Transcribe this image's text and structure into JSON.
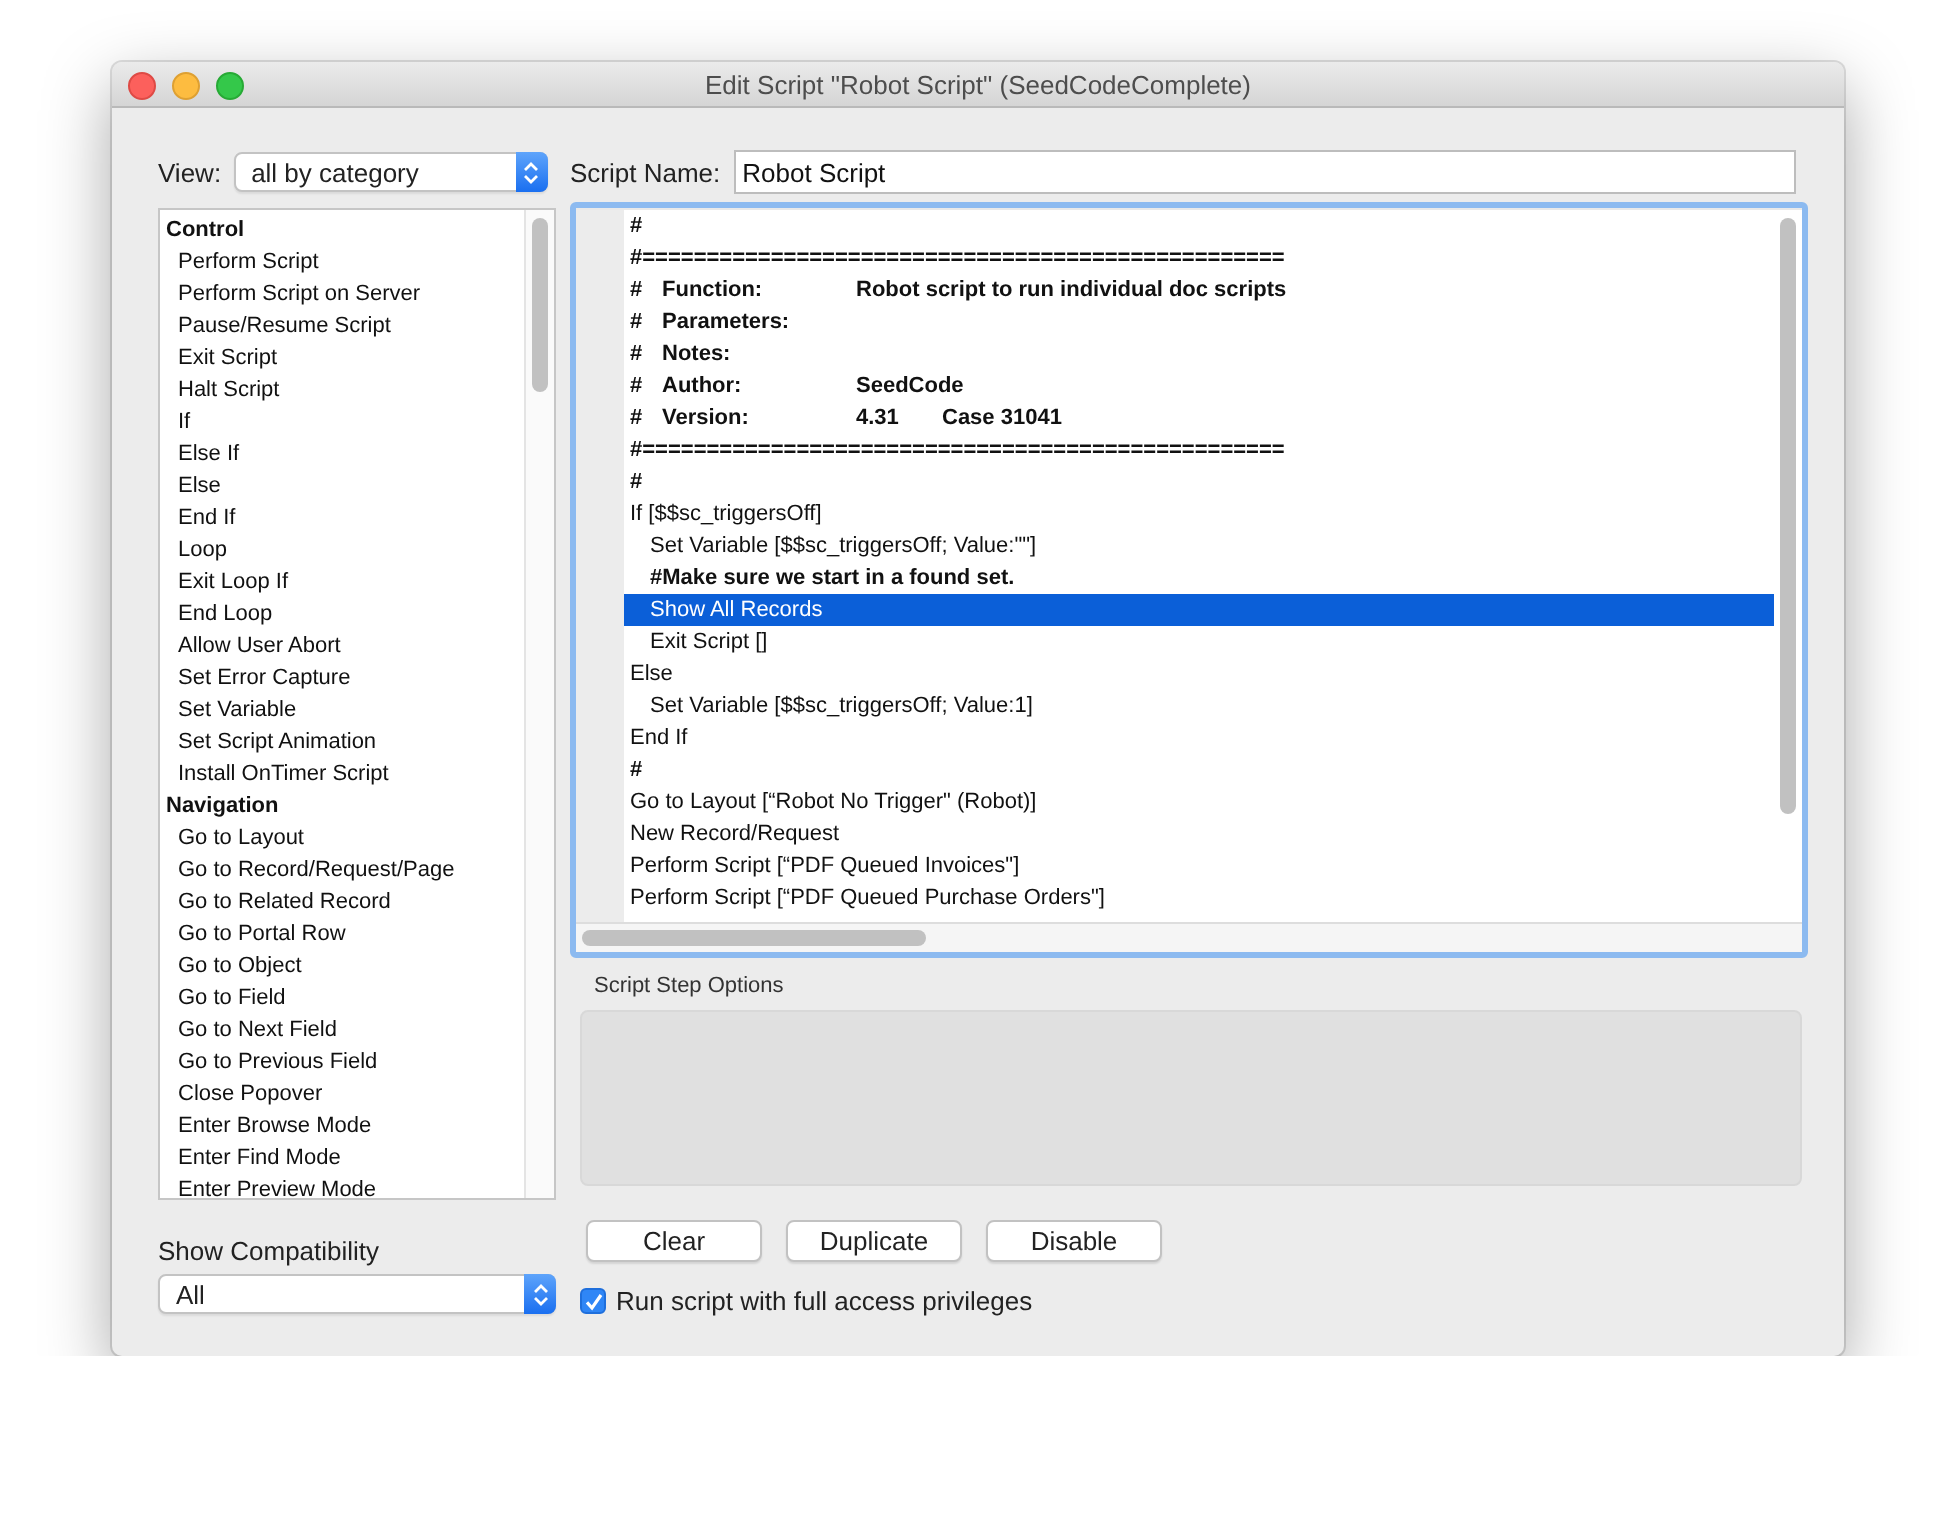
{
  "window": {
    "title": "Edit Script \"Robot Script\" (SeedCodeComplete)"
  },
  "view": {
    "label": "View:",
    "value": "all by category"
  },
  "script_name": {
    "label": "Script Name:",
    "value": "Robot Script"
  },
  "steps_list": {
    "groups": [
      {
        "label": "Control",
        "items": [
          "Perform Script",
          "Perform Script on Server",
          "Pause/Resume Script",
          "Exit Script",
          "Halt Script",
          "If",
          "Else If",
          "Else",
          "End If",
          "Loop",
          "Exit Loop If",
          "End Loop",
          "Allow User Abort",
          "Set Error Capture",
          "Set Variable",
          "Set Script Animation",
          "Install OnTimer Script"
        ]
      },
      {
        "label": "Navigation",
        "items": [
          "Go to Layout",
          "Go to Record/Request/Page",
          "Go to Related Record",
          "Go to Portal Row",
          "Go to Object",
          "Go to Field",
          "Go to Next Field",
          "Go to Previous Field",
          "Close Popover",
          "Enter Browse Mode",
          "Enter Find Mode",
          "Enter Preview Mode"
        ]
      }
    ]
  },
  "script": {
    "lines": [
      {
        "kind": "comment",
        "parts": [
          "#"
        ],
        "selected": false
      },
      {
        "kind": "comment",
        "parts": [
          "#=================================================="
        ],
        "selected": false
      },
      {
        "kind": "comment",
        "parts": [
          "#",
          "Function:",
          "Robot script to run individual doc scripts"
        ],
        "selected": false
      },
      {
        "kind": "comment",
        "parts": [
          "#",
          "Parameters:"
        ],
        "selected": false
      },
      {
        "kind": "comment",
        "parts": [
          "#",
          "Notes:"
        ],
        "selected": false
      },
      {
        "kind": "comment",
        "parts": [
          "#",
          "Author:",
          "SeedCode"
        ],
        "selected": false
      },
      {
        "kind": "comment",
        "parts": [
          "#",
          "Version:",
          "4.31",
          "Case 31041"
        ],
        "selected": false
      },
      {
        "kind": "comment",
        "parts": [
          "#=================================================="
        ],
        "selected": false
      },
      {
        "kind": "comment",
        "parts": [
          "#"
        ],
        "selected": false
      },
      {
        "kind": "step",
        "parts": [
          "If [$$sc_triggersOff]"
        ],
        "selected": false,
        "children": [
          {
            "kind": "step",
            "parts": [
              "Set Variable [$$sc_triggersOff; Value:\"\"]"
            ],
            "selected": false
          },
          {
            "kind": "comment",
            "parts": [
              "#Make sure we start in a found set."
            ],
            "selected": false
          },
          {
            "kind": "step",
            "parts": [
              "Show All Records"
            ],
            "selected": true
          },
          {
            "kind": "step",
            "parts": [
              "Exit Script []"
            ],
            "selected": false
          }
        ]
      },
      {
        "kind": "step",
        "parts": [
          "Else"
        ],
        "selected": false,
        "children": [
          {
            "kind": "step",
            "parts": [
              "Set Variable [$$sc_triggersOff; Value:1]"
            ],
            "selected": false
          }
        ]
      },
      {
        "kind": "step",
        "parts": [
          "End If"
        ],
        "selected": false
      },
      {
        "kind": "comment",
        "parts": [
          "#"
        ],
        "selected": false
      },
      {
        "kind": "step",
        "parts": [
          "Go to Layout [“Robot No Trigger\" (Robot)]"
        ],
        "selected": false
      },
      {
        "kind": "step",
        "parts": [
          "New Record/Request"
        ],
        "selected": false
      },
      {
        "kind": "step",
        "parts": [
          "Perform Script [“PDF Queued Invoices\"]"
        ],
        "selected": false
      },
      {
        "kind": "step",
        "parts": [
          "Perform Script [“PDF Queued Purchase Orders\"]"
        ],
        "selected": false
      }
    ]
  },
  "step_options": {
    "label": "Script Step Options"
  },
  "buttons": [
    "Clear",
    "Duplicate",
    "Disable"
  ],
  "full_access": {
    "label": "Run script with full access privileges",
    "checked": true
  },
  "compatibility": {
    "label": "Show Compatibility",
    "value": "All"
  }
}
